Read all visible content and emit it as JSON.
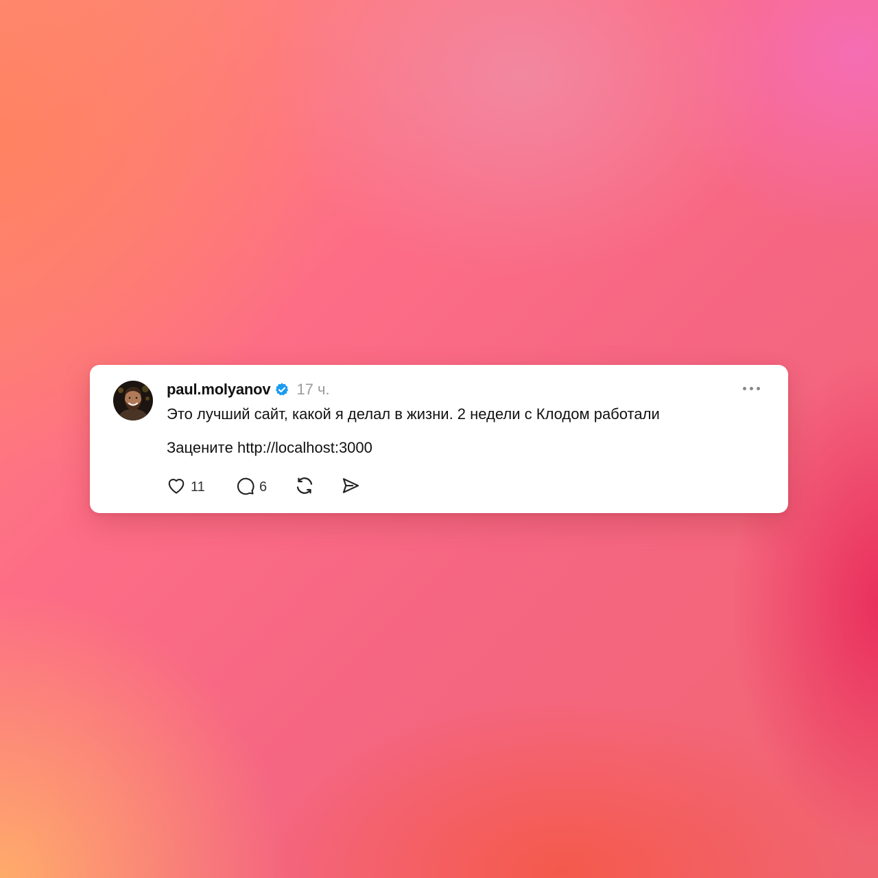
{
  "post": {
    "author": {
      "username": "paul.molyanov",
      "verified": true,
      "avatar_icon": "user-avatar-photo"
    },
    "timestamp": "17 ч.",
    "text_line_1": "Это лучший сайт, какой я делал в жизни. 2 недели с Клодом работали",
    "text_line_2": "Заценитe http://localhost:3000",
    "actions": {
      "like": {
        "icon": "heart-icon",
        "count": "11"
      },
      "reply": {
        "icon": "comment-icon",
        "count": "6"
      },
      "repost": {
        "icon": "repost-icon"
      },
      "share": {
        "icon": "send-icon"
      }
    },
    "menu_icon": "more-options-icon"
  },
  "colors": {
    "card_background": "#ffffff",
    "text_primary": "#111111",
    "text_secondary": "#9a9a9a",
    "verified_badge": "#1d9bf0"
  }
}
